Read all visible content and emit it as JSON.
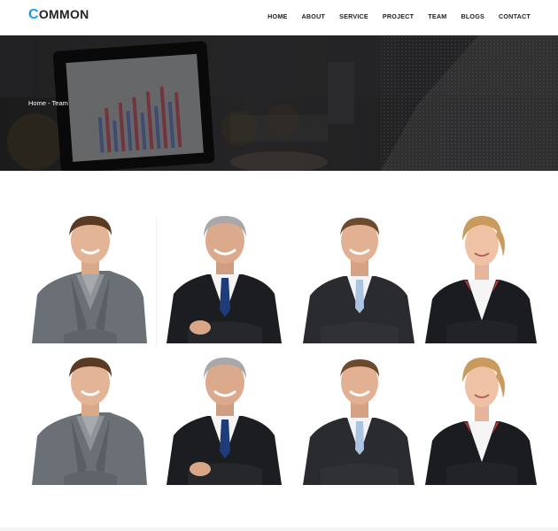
{
  "logo": {
    "first_letter": "C",
    "rest": "OMMON"
  },
  "nav": {
    "items": [
      "HOME",
      "ABOUT",
      "SERVICE",
      "PROJECT",
      "TEAM",
      "BLOGS",
      "CONTACT"
    ]
  },
  "breadcrumb": {
    "text": "Home - Team"
  },
  "colors": {
    "accent": "#1e9be6",
    "hero_dark": "#2d2d2f",
    "text_dark": "#222222"
  },
  "team": {
    "rows": 2,
    "members": [
      "casual-man",
      "grey-haired-businessman",
      "businessman-white-shirt",
      "businesswoman"
    ]
  }
}
